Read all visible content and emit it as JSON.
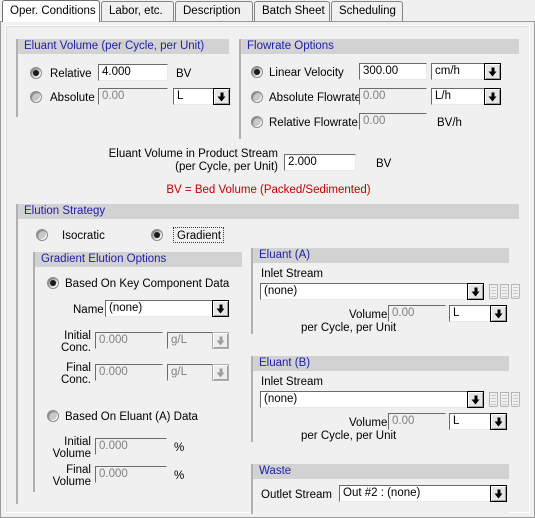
{
  "tabs": [
    {
      "label": "Oper. Conditions",
      "active": true
    },
    {
      "label": "Labor, etc.",
      "active": false
    },
    {
      "label": "Description",
      "active": false
    },
    {
      "label": "Batch Sheet",
      "active": false
    },
    {
      "label": "Scheduling",
      "active": false
    }
  ],
  "eluant_volume": {
    "title": "Eluant Volume (per Cycle, per Unit)",
    "relative": {
      "label": "Relative",
      "value": "4.000",
      "unit": "BV",
      "selected": true
    },
    "absolute": {
      "label": "Absolute",
      "value": "0.00",
      "unit": "L",
      "selected": false
    }
  },
  "flowrate_options": {
    "title": "Flowrate Options",
    "linear_velocity": {
      "label": "Linear Velocity",
      "value": "300.00",
      "unit": "cm/h",
      "selected": true
    },
    "absolute_flowrate": {
      "label": "Absolute Flowrate",
      "value": "0.00",
      "unit": "L/h",
      "selected": false
    },
    "relative_flowrate": {
      "label": "Relative Flowrate",
      "value": "0.00",
      "unit": "BV/h",
      "selected": false
    }
  },
  "product_stream": {
    "label_line1": "Eluant Volume in Product Stream",
    "label_line2": "(per Cycle, per Unit)",
    "value": "2.000",
    "unit": "BV",
    "note": "BV = Bed Volume (Packed/Sedimented)"
  },
  "elution_strategy": {
    "title": "Elution Strategy",
    "isocratic": {
      "label": "Isocratic",
      "selected": false
    },
    "gradient": {
      "label": "Gradient",
      "selected": true,
      "focused": true
    }
  },
  "gradient_options": {
    "title": "Gradient Elution Options",
    "based_on_key_component": {
      "label": "Based On Key Component Data",
      "selected": true
    },
    "name": {
      "label": "Name",
      "value": "(none)"
    },
    "initial_conc": {
      "label_line1": "Initial",
      "label_line2": "Conc.",
      "value": "0.000",
      "unit": "g/L"
    },
    "final_conc": {
      "label_line1": "Final",
      "label_line2": "Conc.",
      "value": "0.000",
      "unit": "g/L"
    },
    "based_on_eluant_a": {
      "label": "Based On Eluant (A) Data",
      "selected": false
    },
    "initial_volume": {
      "label_line1": "Initial",
      "label_line2": "Volume",
      "value": "0.000",
      "unit": "%"
    },
    "final_volume": {
      "label_line1": "Final",
      "label_line2": "Volume",
      "value": "0.000",
      "unit": "%"
    }
  },
  "eluant_a": {
    "title": "Eluant (A)",
    "inlet_stream_label": "Inlet Stream",
    "inlet_stream_value": "(none)",
    "volume_label": "Volume",
    "volume_value": "0.00",
    "volume_unit": "L",
    "per_cycle_label": "per Cycle, per Unit"
  },
  "eluant_b": {
    "title": "Eluant (B)",
    "inlet_stream_label": "Inlet Stream",
    "inlet_stream_value": "(none)",
    "volume_label": "Volume",
    "volume_value": "0.00",
    "volume_unit": "L",
    "per_cycle_label": "per Cycle, per Unit"
  },
  "waste": {
    "title": "Waste",
    "outlet_stream_label": "Outlet Stream",
    "outlet_stream_value": "Out #2 : (none)"
  },
  "colors": {
    "group_title": "#1d1da8",
    "note_red": "#c00000",
    "group_header_bg": "#d2d2d2",
    "window_bg": "#f0f0f0"
  }
}
